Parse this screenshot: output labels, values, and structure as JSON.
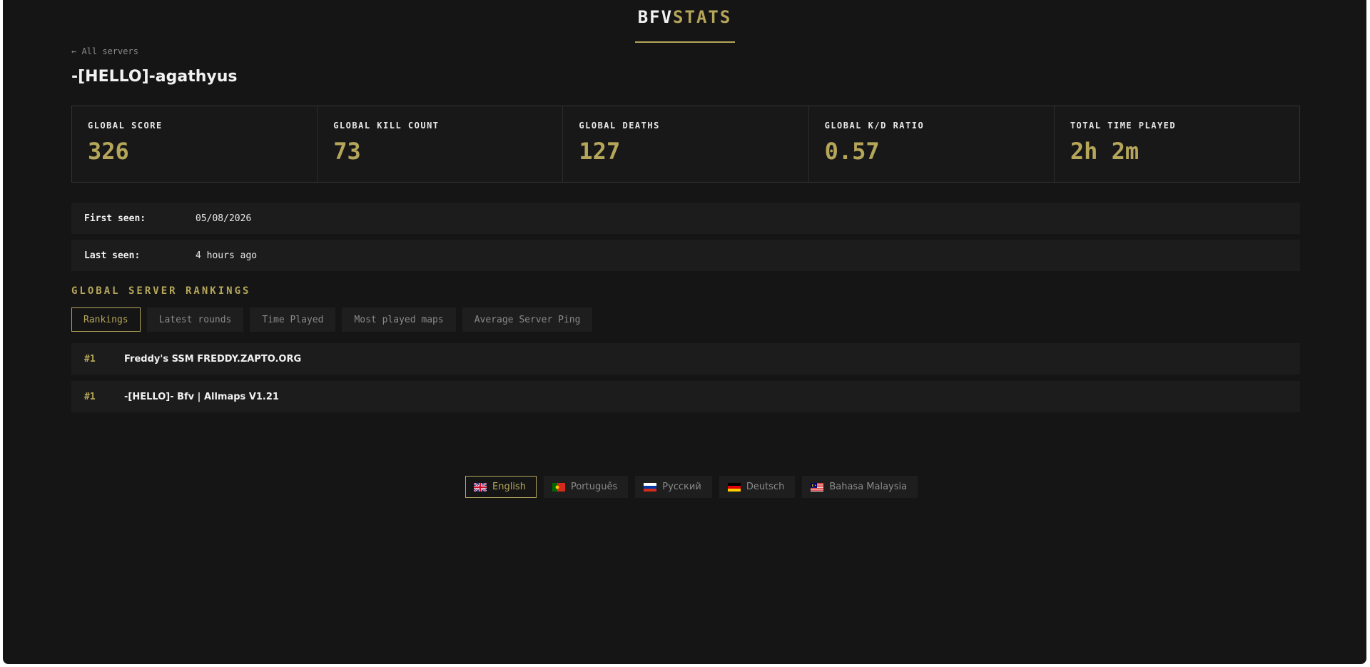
{
  "brand": {
    "part1": "BFV",
    "part2": "STATS"
  },
  "nav": {
    "back_label": "← All servers"
  },
  "player": {
    "name": "-[HELLO]-agathyus"
  },
  "stats": [
    {
      "label": "GLOBAL SCORE",
      "value": "326"
    },
    {
      "label": "GLOBAL KILL COUNT",
      "value": "73"
    },
    {
      "label": "GLOBAL DEATHS",
      "value": "127"
    },
    {
      "label": "GLOBAL K/D RATIO",
      "value": "0.57"
    },
    {
      "label": "TOTAL TIME PLAYED",
      "value": "2h 2m"
    }
  ],
  "info": {
    "first_seen_label": "First seen:",
    "first_seen_value": "05/08/2026",
    "last_seen_label": "Last seen:",
    "last_seen_value": "4 hours ago"
  },
  "rankings": {
    "title": "GLOBAL SERVER RANKINGS",
    "tabs": [
      {
        "label": "Rankings",
        "active": true
      },
      {
        "label": "Latest rounds",
        "active": false
      },
      {
        "label": "Time Played",
        "active": false
      },
      {
        "label": "Most played maps",
        "active": false
      },
      {
        "label": "Average Server Ping",
        "active": false
      }
    ],
    "rows": [
      {
        "rank": "#1",
        "server": "Freddy's SSM FREDDY.ZAPTO.ORG"
      },
      {
        "rank": "#1",
        "server": "-[HELLO]- Bfv | Allmaps V1.21"
      }
    ]
  },
  "languages": [
    {
      "label": "English",
      "flag": "uk-flag-icon",
      "active": true
    },
    {
      "label": "Português",
      "flag": "portugal-flag-icon",
      "active": false
    },
    {
      "label": "Русский",
      "flag": "russia-flag-icon",
      "active": false
    },
    {
      "label": "Deutsch",
      "flag": "germany-flag-icon",
      "active": false
    },
    {
      "label": "Bahasa Malaysia",
      "flag": "malaysia-flag-icon",
      "active": false
    }
  ],
  "colors": {
    "accent": "#b5a65a",
    "background": "#151515",
    "panel": "#1c1c1d"
  }
}
